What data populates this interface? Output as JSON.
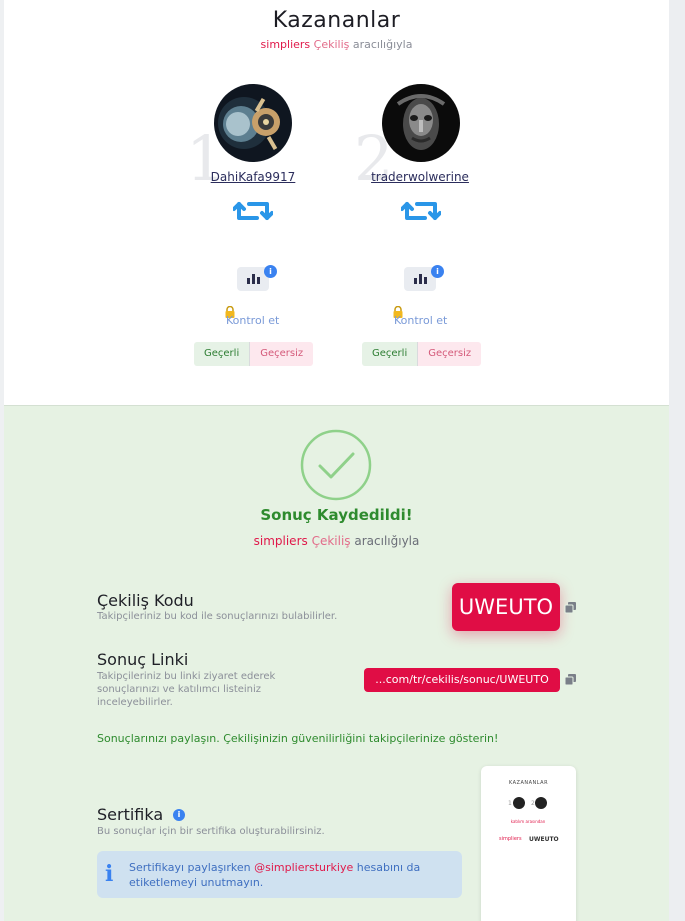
{
  "header": {
    "title": "Kazananlar",
    "brand": "simpliers",
    "subtitle_brand_word": "Çekiliş",
    "subtitle_rest": "aracılığıyla"
  },
  "winners": [
    {
      "rank": "1",
      "username": "DahiKafa9917",
      "avatar_icon": "avatar-dark-blue-icon",
      "kontrol_label": "Kontrol et",
      "valid_label": "Geçerli",
      "invalid_label": "Geçersiz"
    },
    {
      "rank": "2",
      "username": "traderwolwerine",
      "avatar_icon": "avatar-dark-face-icon",
      "kontrol_label": "Kontrol et",
      "valid_label": "Geçerli",
      "invalid_label": "Geçersiz"
    }
  ],
  "result": {
    "title": "Sonuç Kaydedildi!",
    "brand": "simpliers",
    "brand_word": "Çekiliş",
    "rest": "aracılığıyla"
  },
  "code_section": {
    "title": "Çekiliş Kodu",
    "desc": "Takipçileriniz bu kod ile sonuçlarınızı bulabilirler.",
    "code": "UWEUTO"
  },
  "link_section": {
    "title": "Sonuç Linki",
    "desc_line1": "Takipçileriniz bu linki ziyaret ederek",
    "desc_line2": "sonuçlarınızı ve katılımcı listeiniz",
    "desc_line3": "inceleyebilirler.",
    "link": "...com/tr/cekilis/sonuc/UWEUTO"
  },
  "share_text": "Sonuçlarınızı paylaşın. Çekilişinizin güvenilirliğini takipçilerinize gösterin!",
  "certificate": {
    "title": "Sertifika",
    "desc": "Bu sonuçlar için bir sertifika oluşturabilirsiniz.",
    "alert_pre": "Sertifikayı paylaşırken",
    "alert_handle": "@simpliersturkiye",
    "alert_post": "hesabını da",
    "alert_line2": "etiketlemeyi unutmayın.",
    "preview_title": "KAZANANLAR",
    "preview_brand": "simpliers",
    "preview_code": "UWEUTO",
    "preview_caption": "katılım arasından"
  },
  "colors": {
    "brand": "#e0194a",
    "success": "#2e8b2e",
    "info": "#3a82f0",
    "panel_green": "#e6f2e3"
  }
}
